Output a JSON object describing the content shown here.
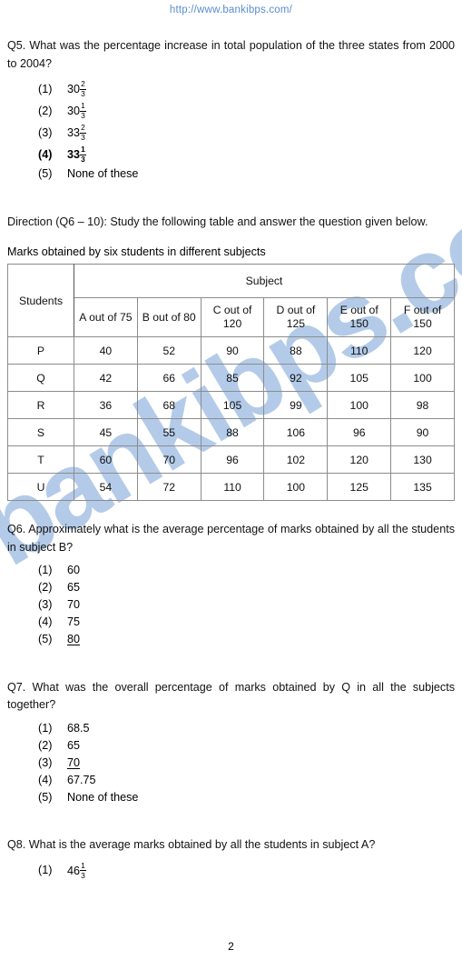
{
  "header": {
    "site_url": "http://www.bankibps.com/",
    "url_color": "#5b8dd0"
  },
  "watermark": {
    "text": "bankibps.com",
    "color": "#b3cbe8"
  },
  "questions": [
    {
      "id": "q5",
      "text": "Q5.  What  was  the  percentage  increase  in  total  population  of  the  three states from 2000 to 2004?",
      "options": [
        {
          "num": "(1)",
          "whole": "30",
          "numerator": "2",
          "denominator": "3",
          "bold": false,
          "underline": false
        },
        {
          "num": "(2)",
          "whole": "30",
          "numerator": "1",
          "denominator": "3",
          "bold": false,
          "underline": false
        },
        {
          "num": "(3)",
          "whole": "33",
          "numerator": "2",
          "denominator": "3",
          "bold": false,
          "underline": false
        },
        {
          "num": "(4)",
          "whole": "33",
          "numerator": "1",
          "denominator": "3",
          "bold": true,
          "underline": false
        },
        {
          "num": "(5)",
          "value": "None of these",
          "bold": false,
          "underline": false
        }
      ]
    },
    {
      "id": "q6",
      "text": "Q6.  Approximately  what  is  the  average  percentage  of  marks  obtained  by all the students in subject B?",
      "options": [
        {
          "num": "(1)",
          "value": "60",
          "bold": false,
          "underline": false
        },
        {
          "num": "(2)",
          "value": "65",
          "bold": false,
          "underline": false
        },
        {
          "num": "(3)",
          "value": "70",
          "bold": false,
          "underline": false
        },
        {
          "num": "(4)",
          "value": "75",
          "bold": false,
          "underline": false
        },
        {
          "num": "(5)",
          "value": "80",
          "bold": false,
          "underline": true
        }
      ]
    },
    {
      "id": "q7",
      "text": "Q7.  What  was  the  overall  percentage  of  marks  obtained  by  Q  in  all  the subjects together?",
      "options": [
        {
          "num": "(1)",
          "value": "68.5",
          "bold": false,
          "underline": false
        },
        {
          "num": "(2)",
          "value": "65",
          "bold": false,
          "underline": false
        },
        {
          "num": "(3)",
          "value": "70",
          "bold": false,
          "underline": true
        },
        {
          "num": "(4)",
          "value": "67.75",
          "bold": false,
          "underline": false
        },
        {
          "num": "(5)",
          "value": "None of these",
          "bold": false,
          "underline": false
        }
      ]
    },
    {
      "id": "q8",
      "text": "Q8. What is the average marks obtained by all the students in subject A?",
      "options": [
        {
          "num": "(1)",
          "whole": "46",
          "numerator": "1",
          "denominator": "3",
          "bold": false,
          "underline": false
        }
      ]
    }
  ],
  "direction": {
    "text": "Direction  (Q6  –  10):  Study  the  following  table  and  answer  the  question given below."
  },
  "table": {
    "caption": "Marks obtained by six students in different subjects",
    "corner_header": "Students",
    "group_header": "Subject",
    "column_headers": [
      "A out of 75",
      "B out of 80",
      "C out of 120",
      "D out of 125",
      "E out of 150",
      "F out of 150"
    ],
    "rows": [
      {
        "student": "P",
        "values": [
          "40",
          "52",
          "90",
          "88",
          "110",
          "120"
        ]
      },
      {
        "student": "Q",
        "values": [
          "42",
          "66",
          "85",
          "92",
          "105",
          "100"
        ]
      },
      {
        "student": "R",
        "values": [
          "36",
          "68",
          "105",
          "99",
          "100",
          "98"
        ]
      },
      {
        "student": "S",
        "values": [
          "45",
          "55",
          "88",
          "106",
          "96",
          "90"
        ]
      },
      {
        "student": "T",
        "values": [
          "60",
          "70",
          "96",
          "102",
          "120",
          "130"
        ]
      },
      {
        "student": "U",
        "values": [
          "54",
          "72",
          "110",
          "100",
          "125",
          "135"
        ]
      }
    ]
  },
  "footer": {
    "page_number": "2"
  }
}
